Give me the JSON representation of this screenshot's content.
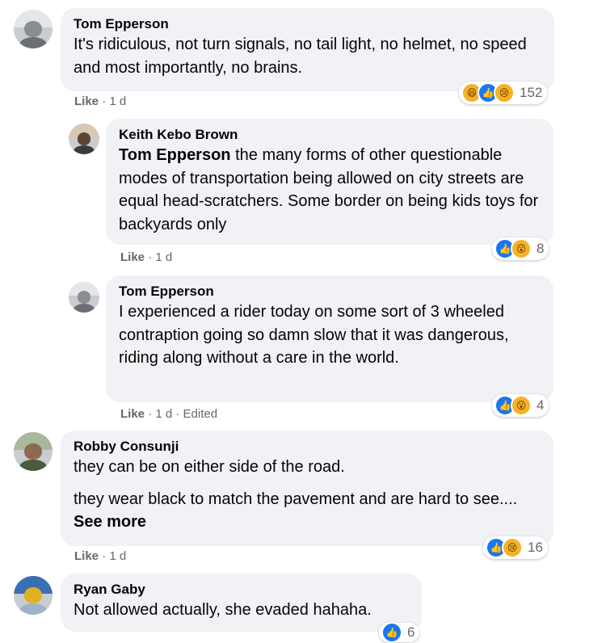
{
  "comments": [
    {
      "name": "Tom Epperson",
      "text": "It's ridiculous, not turn signals, no tail light, no helmet, no speed and most importantly, no brains.",
      "like": "Like",
      "time": "· 1 d",
      "reactions": [
        "haha",
        "like",
        "sad"
      ],
      "count": "152"
    },
    {
      "name": "Keith Kebo Brown",
      "tag": "Tom Epperson",
      "text": " the many forms of other questionable modes of transportation being allowed on city streets are equal head-scratchers. Some border on being kids toys for backyards only",
      "like": "Like",
      "time": "· 1 d",
      "reactions": [
        "like",
        "wow"
      ],
      "count": "8"
    },
    {
      "name": "Tom Epperson",
      "text": "I experienced a rider today on some sort of 3 wheeled contraption going so damn slow that it was dangerous, riding along without a care in the world.",
      "like": "Like",
      "time": "· 1 d · Edited",
      "reactions": [
        "like",
        "wow"
      ],
      "count": "4"
    },
    {
      "name": "Robby Consunji",
      "text1": "they can be on either side of the road.",
      "text2": "they wear black to match the pavement and are hard to see....",
      "see_more": "See more",
      "like": "Like",
      "time": "· 1 d",
      "reactions": [
        "like",
        "sad"
      ],
      "count": "16"
    },
    {
      "name": "Ryan Gaby",
      "text": "Not allowed actually, she evaded hahaha.",
      "reactions": [
        "like"
      ],
      "count": "6"
    }
  ],
  "colors": {
    "bubble": "#f0f2f5",
    "meta": "#65676b",
    "like_blue": "#1877f2",
    "emoji_yellow": "#f7b125"
  }
}
